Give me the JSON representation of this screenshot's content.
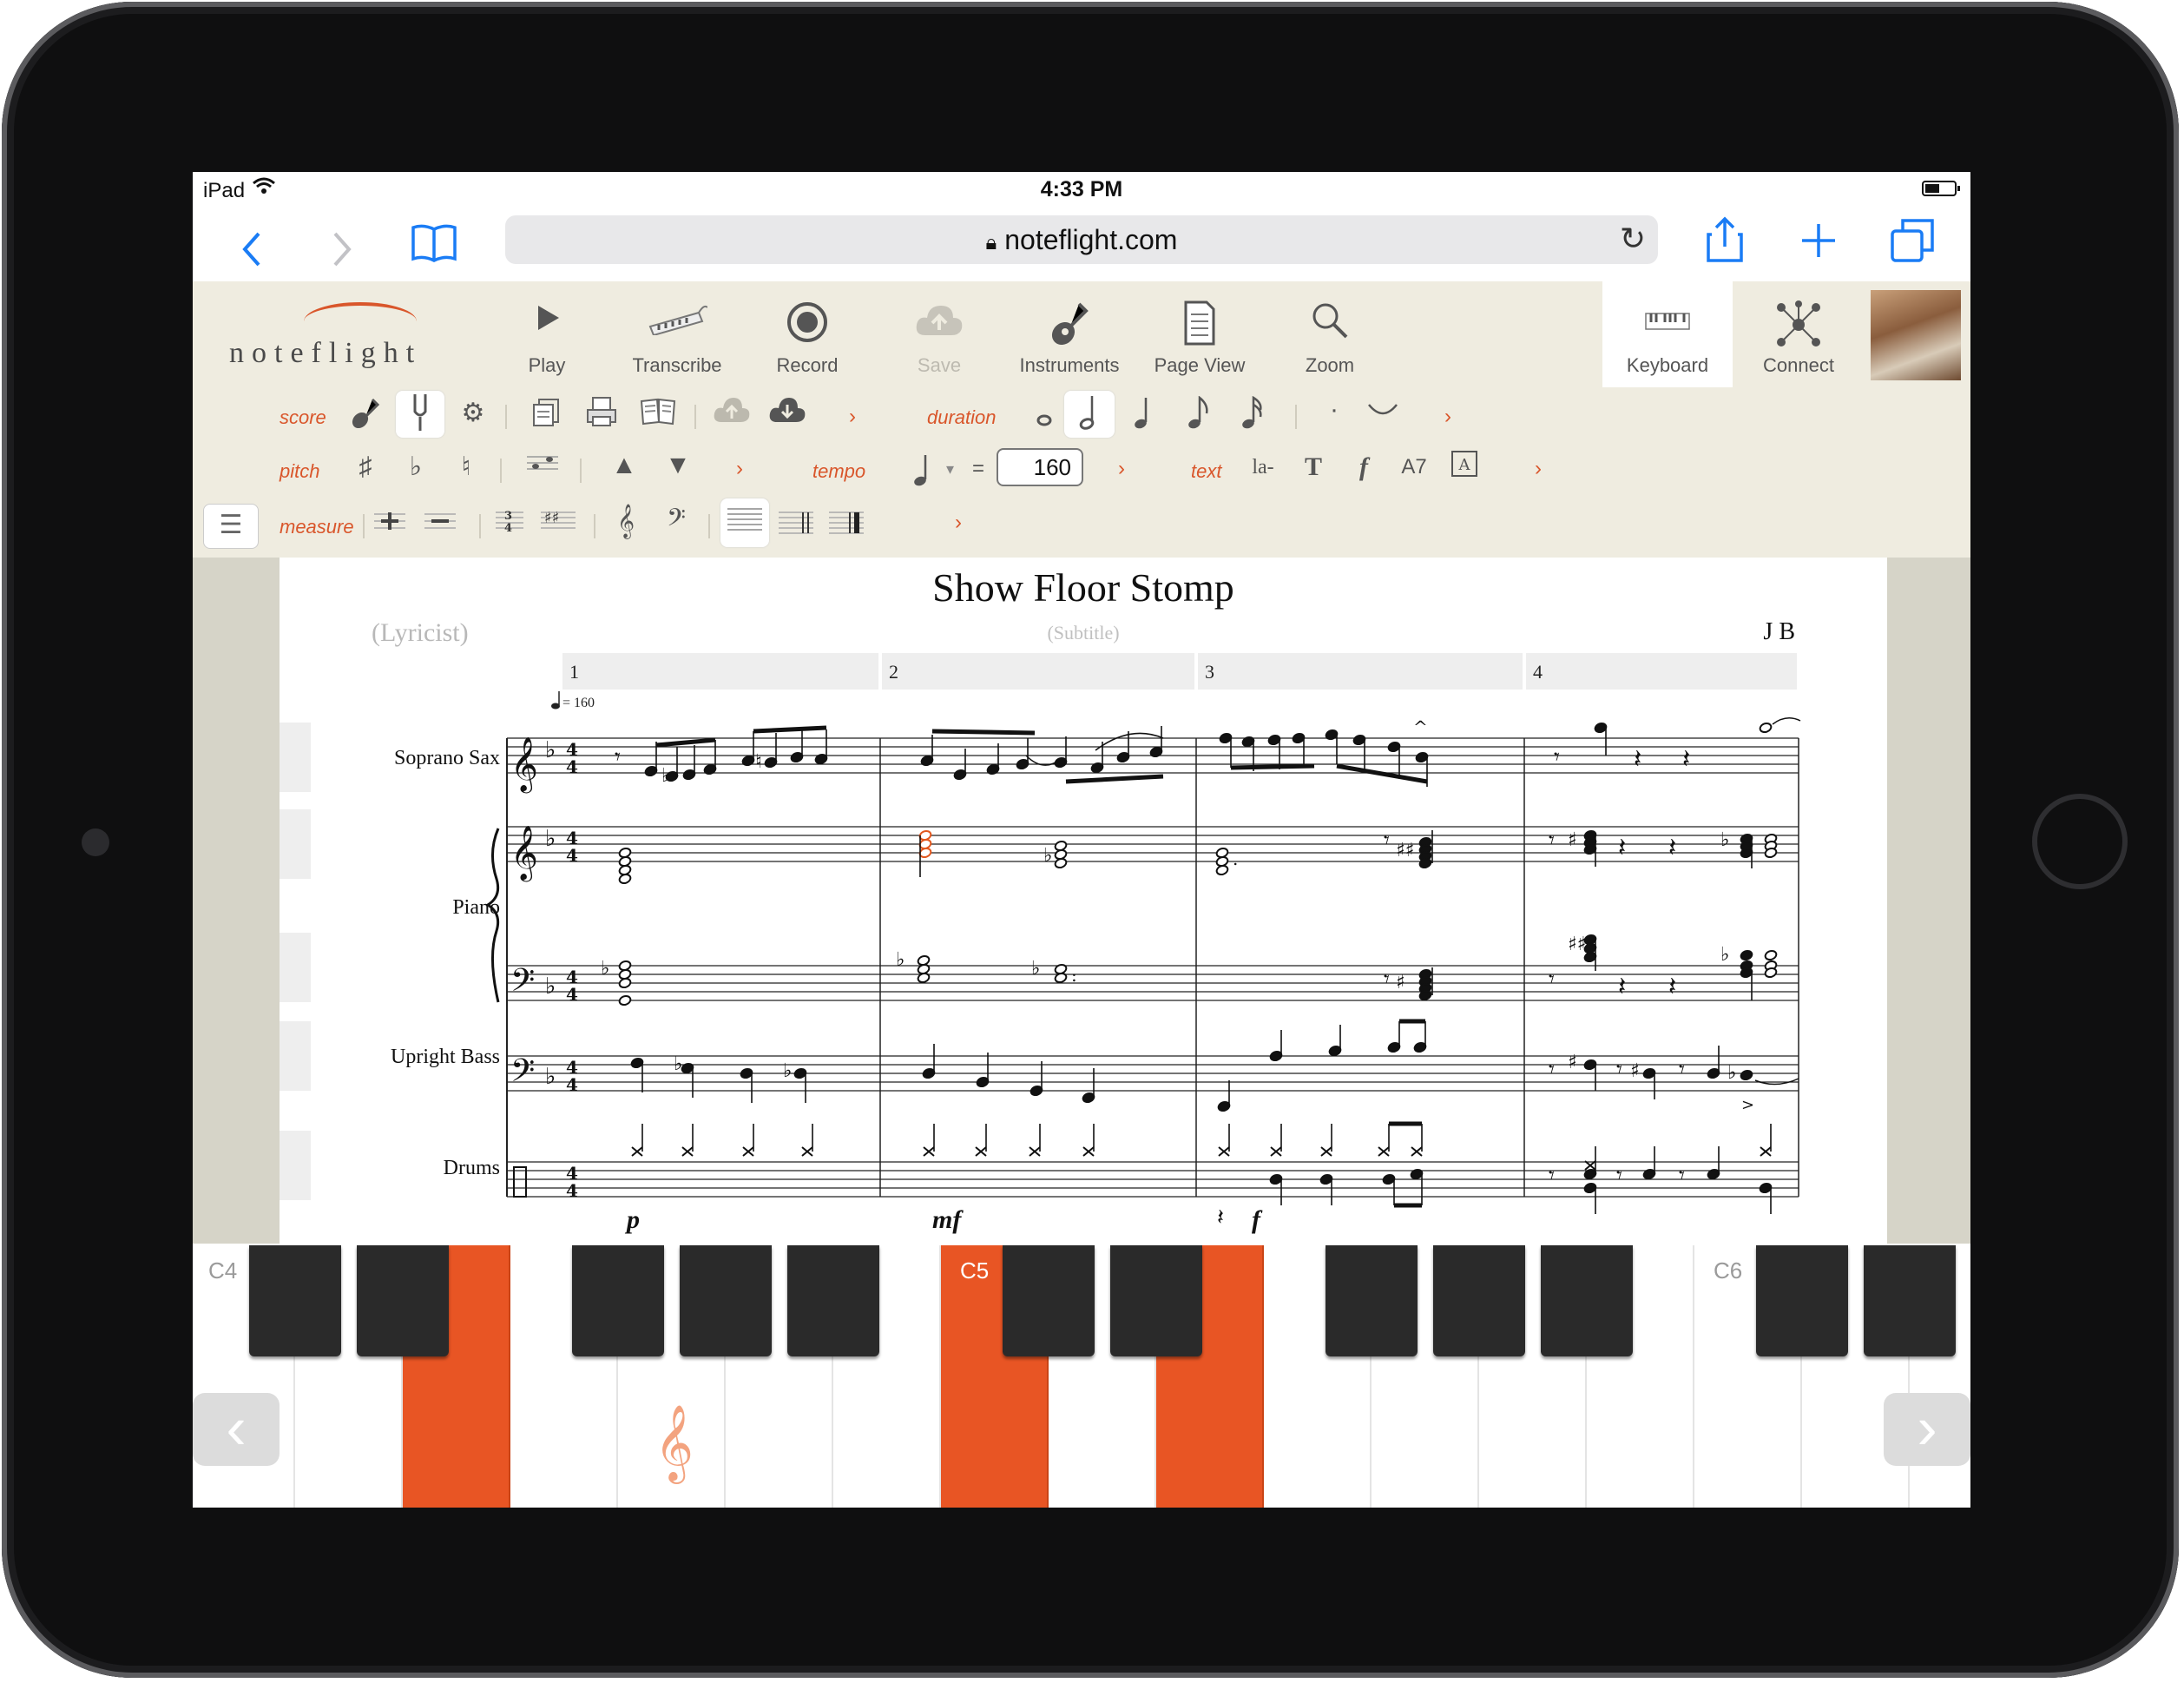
{
  "status": {
    "carrier": "iPad",
    "time": "4:33 PM"
  },
  "safari": {
    "url": "noteflight.com"
  },
  "app": {
    "logo": "noteflight",
    "toolbar": [
      {
        "label": "Play",
        "icon": "play-icon"
      },
      {
        "label": "Transcribe",
        "icon": "keyboard-icon"
      },
      {
        "label": "Record",
        "icon": "record-icon"
      },
      {
        "label": "Save",
        "icon": "cloud-icon"
      },
      {
        "label": "Instruments",
        "icon": "guitar-icon"
      },
      {
        "label": "Page View",
        "icon": "page-icon"
      },
      {
        "label": "Zoom",
        "icon": "zoom-icon"
      },
      {
        "label": "Keyboard",
        "icon": "piano-icon"
      },
      {
        "label": "Connect",
        "icon": "connect-icon"
      }
    ]
  },
  "palette": {
    "score_label": "score",
    "duration_label": "duration",
    "pitch_label": "pitch",
    "tempo_label": "tempo",
    "tempo_value": "160",
    "text_label": "text",
    "text_items": {
      "lyric": "la-",
      "chord": "A7"
    },
    "measure_label": "measure"
  },
  "score": {
    "title": "Show Floor Stomp",
    "lyricist": "(Lyricist)",
    "subtitle": "(Subtitle)",
    "composer": "J B",
    "tempo_marking": "= 160",
    "measures": [
      "1",
      "2",
      "3",
      "4"
    ],
    "instruments": [
      "Soprano Sax",
      "Piano",
      "Upright Bass",
      "Drums"
    ],
    "dynamics": [
      "p",
      "mf",
      "f"
    ]
  },
  "keyboard": {
    "labels": [
      "C4",
      "C5",
      "C6"
    ],
    "active_white_keys": [
      "E4",
      "C5",
      "E5"
    ],
    "colors": {
      "accent": "#e85524"
    }
  }
}
